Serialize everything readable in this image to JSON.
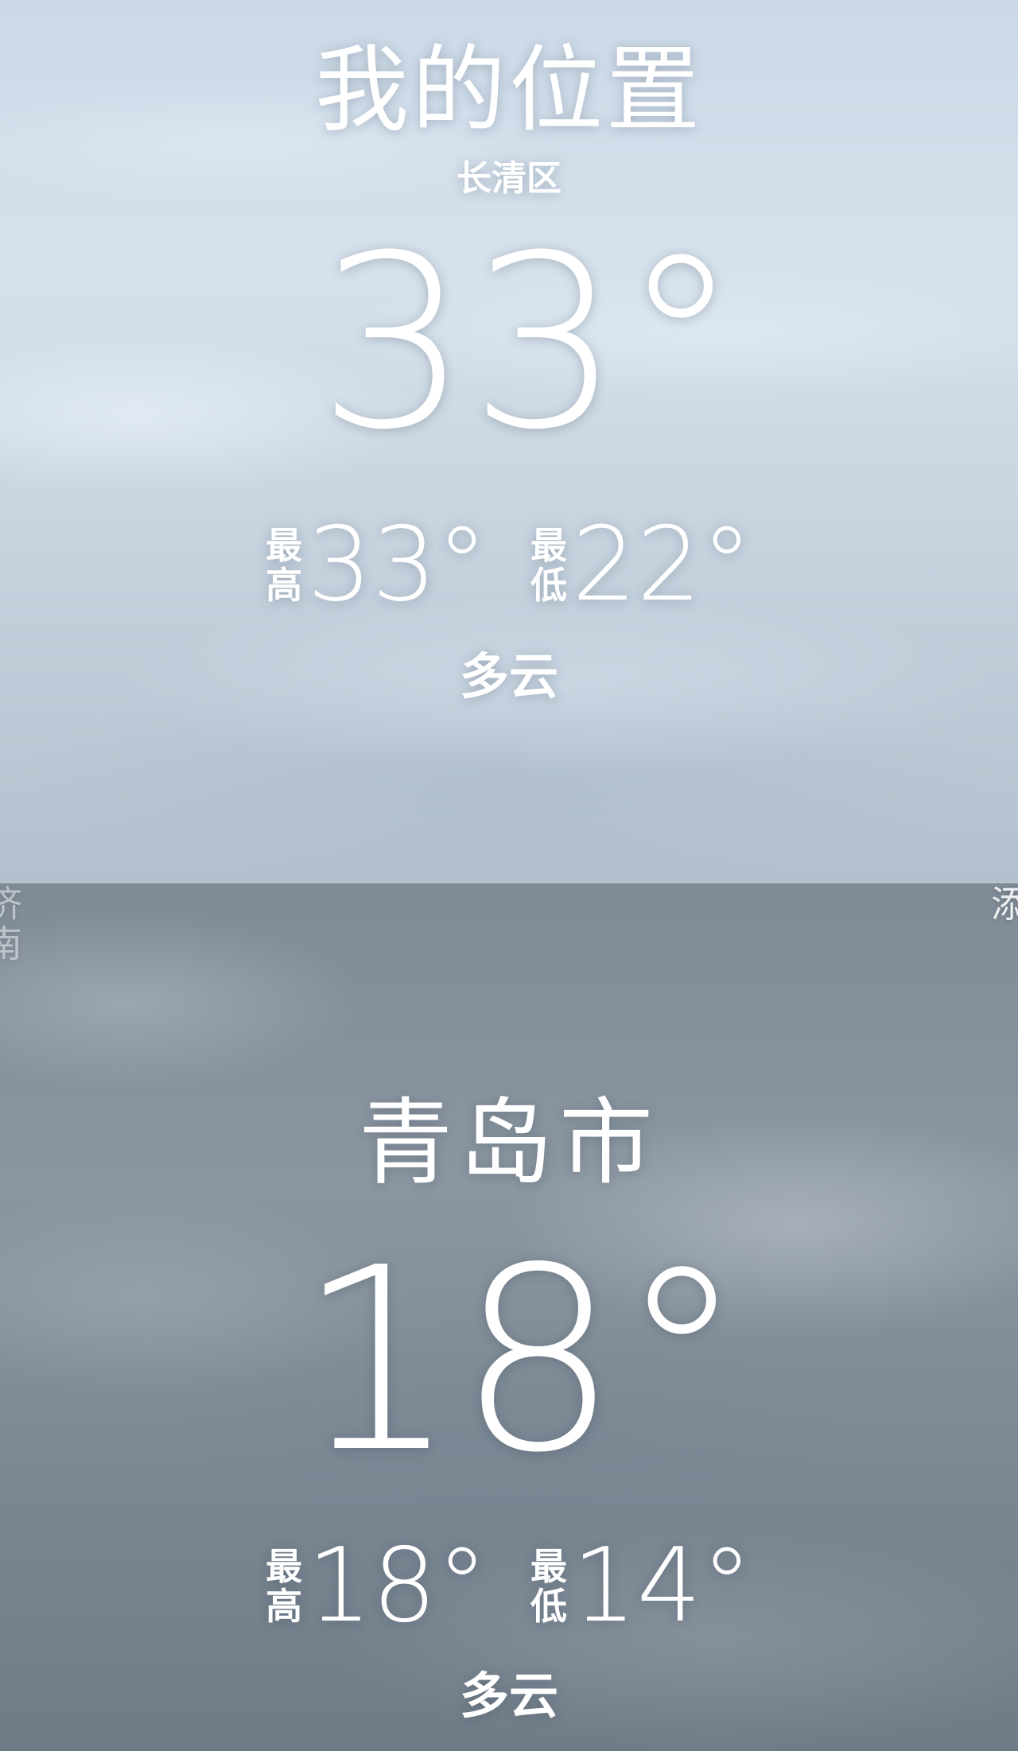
{
  "cities": [
    {
      "title": "我的位置",
      "subtitle": "长清区",
      "temperature": "33°",
      "high_label_1": "最",
      "high_label_2": "高",
      "high": "33°",
      "low_label_1": "最",
      "low_label_2": "低",
      "low": "22°",
      "condition": "多云"
    },
    {
      "title": "青岛市",
      "temperature": "18°",
      "high_label_1": "最",
      "high_label_2": "高",
      "high": "18°",
      "low_label_1": "最",
      "low_label_2": "低",
      "low": "14°",
      "condition": "多云"
    }
  ],
  "edges": {
    "left_text": "济南",
    "right_text": "添"
  },
  "colors": {
    "text": "#ffffff",
    "top_sky": "#d0dce8",
    "bottom_sky": "#85919d"
  }
}
